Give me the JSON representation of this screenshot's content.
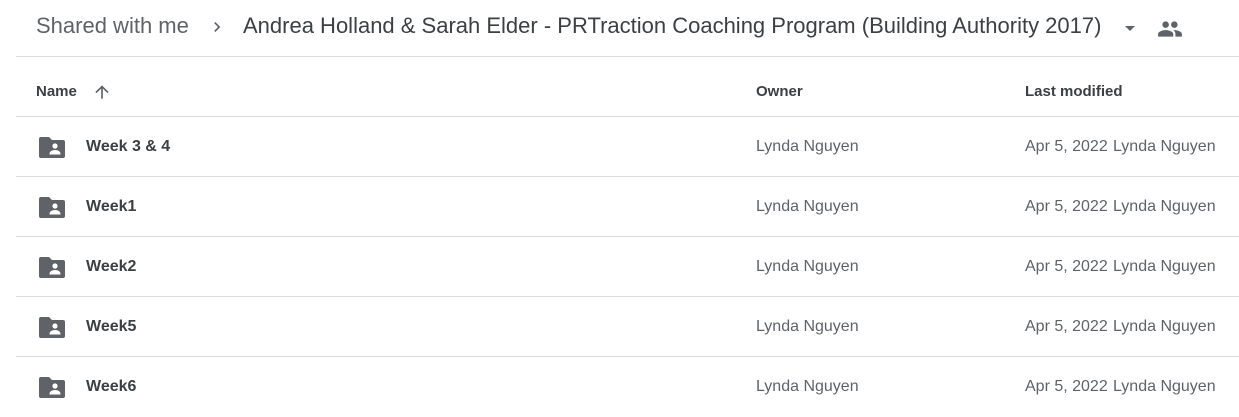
{
  "breadcrumb": {
    "root_label": "Shared with me",
    "current_label": "Andrea Holland & Sarah Elder - PRTraction Coaching Program (Building Authority 2017)",
    "separator_icon": "chevron-right-icon",
    "dropdown_icon": "arrow-drop-down-icon",
    "shared_icon": "people-icon"
  },
  "table": {
    "columns": {
      "name": "Name",
      "owner": "Owner",
      "last_modified": "Last modified"
    },
    "sort_icon": "arrow-upward-icon",
    "rows": [
      {
        "name": "Week 3 & 4",
        "owner": "Lynda Nguyen",
        "modified_date": "Apr 5, 2022",
        "modified_by": "Lynda Nguyen"
      },
      {
        "name": "Week1",
        "owner": "Lynda Nguyen",
        "modified_date": "Apr 5, 2022",
        "modified_by": "Lynda Nguyen"
      },
      {
        "name": "Week2",
        "owner": "Lynda Nguyen",
        "modified_date": "Apr 5, 2022",
        "modified_by": "Lynda Nguyen"
      },
      {
        "name": "Week5",
        "owner": "Lynda Nguyen",
        "modified_date": "Apr 5, 2022",
        "modified_by": "Lynda Nguyen"
      },
      {
        "name": "Week6",
        "owner": "Lynda Nguyen",
        "modified_date": "Apr 5, 2022",
        "modified_by": "Lynda Nguyen"
      }
    ]
  },
  "colors": {
    "icon": "#5f6368",
    "divider": "#dadce0",
    "text_primary": "#3c4043",
    "text_secondary": "#5f6368"
  }
}
